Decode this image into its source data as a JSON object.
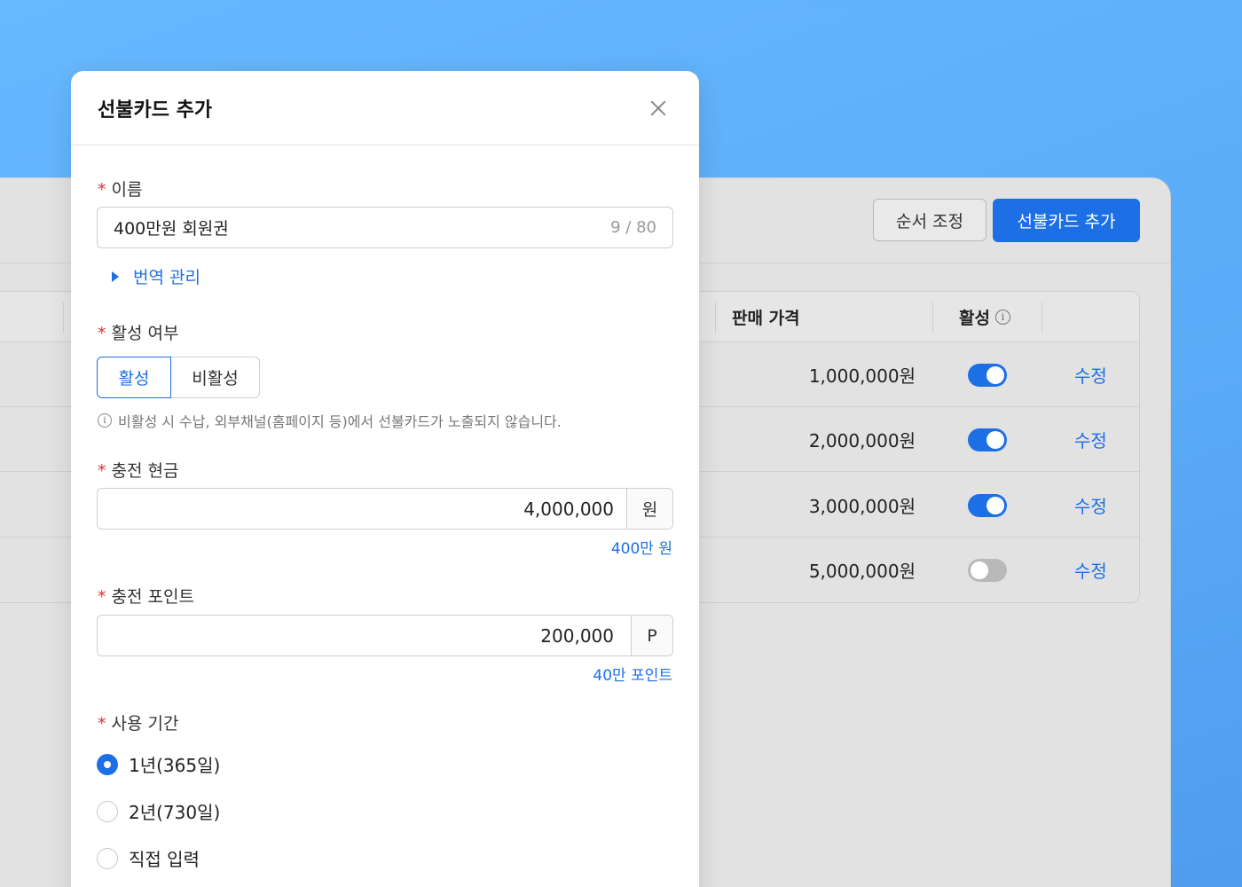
{
  "background": {
    "buttons": {
      "order_label": "순서 조정",
      "add_label": "선불카드 추가"
    },
    "table": {
      "headers": {
        "price": "판매 가격",
        "active": "활성"
      },
      "rows": [
        {
          "price": "1,000,000원",
          "active": true,
          "edit": "수정"
        },
        {
          "price": "2,000,000원",
          "active": true,
          "edit": "수정"
        },
        {
          "price": "3,000,000원",
          "active": true,
          "edit": "수정"
        },
        {
          "price": "5,000,000원",
          "active": false,
          "edit": "수정"
        }
      ]
    }
  },
  "modal": {
    "title": "선불카드 추가",
    "name": {
      "label": "이름",
      "value": "400만원 회원권",
      "counter": "9 / 80"
    },
    "translate_label": "번역 관리",
    "active": {
      "label": "활성 여부",
      "options": [
        "활성",
        "비활성"
      ],
      "selected": "활성",
      "hint": "비활성 시 수납, 외부채널(홈페이지 등)에서 선불카드가 노출되지 않습니다."
    },
    "cash": {
      "label": "충전 현금",
      "value": "4,000,000",
      "unit": "원",
      "sub": "400만 원"
    },
    "point": {
      "label": "충전 포인트",
      "value": "200,000",
      "unit": "P",
      "sub": "40만 포인트"
    },
    "period": {
      "label": "사용 기간",
      "options": [
        "1년(365일)",
        "2년(730일)",
        "직접 입력"
      ],
      "selected": "1년(365일)"
    }
  },
  "colors": {
    "accent": "#1d6fe6",
    "required": "#e03232",
    "background": "#62b4fd"
  }
}
